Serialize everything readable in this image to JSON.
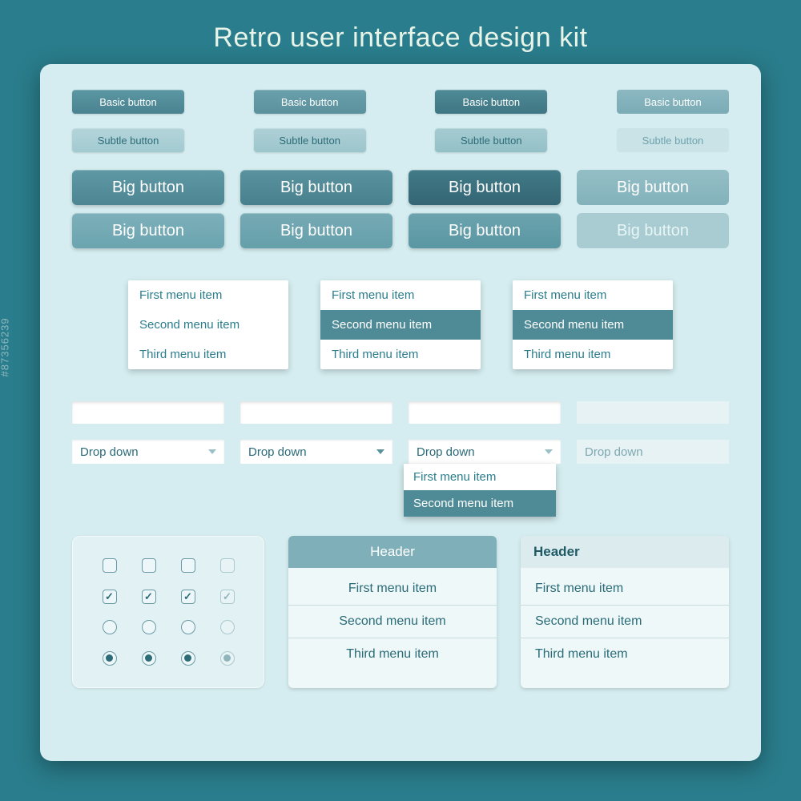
{
  "title": "Retro user interface design kit",
  "watermark": "#87356239",
  "buttons": {
    "basic": "Basic button",
    "subtle": "Subtle button",
    "big": "Big button"
  },
  "menu": {
    "items": [
      "First menu item",
      "Second menu item",
      "Third menu item"
    ]
  },
  "dropdown": {
    "label": "Drop down",
    "open_items": [
      "First menu item",
      "Second menu item"
    ]
  },
  "card": {
    "header": "Header",
    "items": [
      "First menu item",
      "Second menu item",
      "Third menu item"
    ]
  }
}
